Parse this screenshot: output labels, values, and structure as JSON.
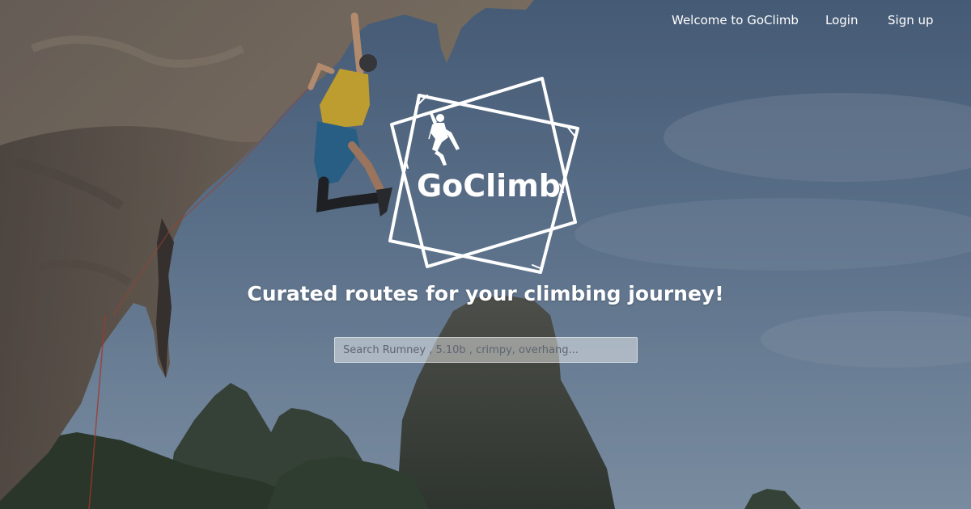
{
  "nav": {
    "welcome": "Welcome to GoClimb",
    "login": "Login",
    "signup": "Sign up"
  },
  "logo": {
    "text": "GoClimb",
    "icon": "climber-icon"
  },
  "hero": {
    "tagline": "Curated routes for your climbing journey!",
    "background": "climber-hanging-on-overhang-photo"
  },
  "search": {
    "placeholder": "Search Rumney , 5.10b , crimpy, overhang...",
    "value": ""
  },
  "colors": {
    "sky": "#5d7593",
    "rock": "#6d6055",
    "forest": "#2f3b2d",
    "text": "#ffffff"
  }
}
